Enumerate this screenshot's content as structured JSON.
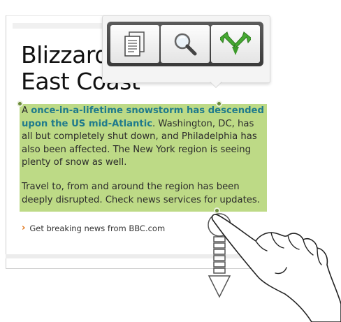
{
  "article": {
    "headline_line1": "Blizzard",
    "headline_line2": "East Coast",
    "p1_prefix": "A ",
    "p1_highlight": "once-in-a-lifetime snowstorm has descended upon the US mid-Atlantic",
    "p1_rest": ". Washington, DC, has all but completely shut down, and Philadelphia has also been affected. The New York region is seeing plenty of snow as well.",
    "p2": "Travel to, from and around the region has been deeply disrupted. Check news services for updates.",
    "more_link": "Get breaking news from BBC.com"
  },
  "toolbar": {
    "items": [
      {
        "name": "copy",
        "icon": "copy-icon"
      },
      {
        "name": "find",
        "icon": "search-icon"
      },
      {
        "name": "share",
        "icon": "share-icon"
      }
    ]
  },
  "colors": {
    "selection": "#b8d77d",
    "highlight_text": "#1f7a8c",
    "link_arrow": "#e07010"
  }
}
